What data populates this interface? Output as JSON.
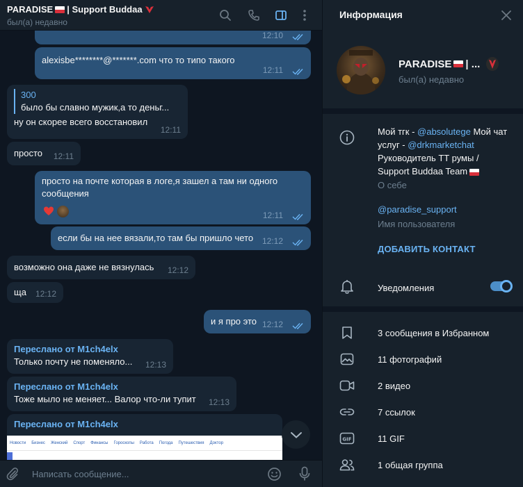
{
  "chat": {
    "title": "PARADISE",
    "title_suffix": "| Support Buddaa",
    "status": "был(а) недавно",
    "composer_placeholder": "Написать сообщение..."
  },
  "messages": [
    {
      "id": "m0",
      "dir": "out",
      "text": "",
      "time": "12:10"
    },
    {
      "id": "m1",
      "dir": "out",
      "text": "alexisbe********@*******.com что то типо такого",
      "time": "12:11"
    },
    {
      "id": "m2",
      "dir": "in",
      "reply_name": "300",
      "reply_text": "было бы славно мужик,а то деньг...",
      "text": "ну он скорее всего восстановил",
      "time": "12:11"
    },
    {
      "id": "m3",
      "dir": "in",
      "text": "просто",
      "time": "12:11"
    },
    {
      "id": "m4",
      "dir": "out",
      "text": "просто на почте которая в логе,я зашел а там ни одного сообщения",
      "time": "12:11",
      "reactions": [
        "heart",
        "avatar"
      ]
    },
    {
      "id": "m5",
      "dir": "out",
      "text": "если бы на нее вязали,то там бы пришло чето",
      "time": "12:12"
    },
    {
      "id": "m6",
      "dir": "in",
      "text": "возможно она даже не вязнулась",
      "time": "12:12"
    },
    {
      "id": "m7",
      "dir": "in",
      "text": "ща",
      "time": "12:12"
    },
    {
      "id": "m8",
      "dir": "out",
      "text": "и я про это",
      "time": "12:12"
    },
    {
      "id": "m9",
      "dir": "in",
      "fwd": "Переслано от M1ch4elx",
      "text": "Только почту не поменяло...",
      "time": "12:13"
    },
    {
      "id": "m10",
      "dir": "in",
      "fwd": "Переслано от M1ch4elx",
      "text": "Тоже мыло не меняет... Валор что-ли тупит",
      "time": "12:13"
    },
    {
      "id": "m11",
      "dir": "in",
      "fwd": "Переслано от M1ch4elx",
      "text": "",
      "time": ""
    }
  ],
  "preview_strip": {
    "tabs": [
      "Новости",
      "Бизнес",
      "Женский",
      "Спорт",
      "Финансы",
      "Гороскопы",
      "Работа",
      "Погода",
      "Путешествия",
      "Доктор"
    ]
  },
  "info": {
    "title": "Информация",
    "profile_name": "PARADISE",
    "profile_name_suffix": "| ...",
    "profile_status": "был(а) недавно",
    "bio_prefix": "Мой тгк - ",
    "bio_handle1": "@absolutege",
    "bio_mid": " Мой чат услуг - ",
    "bio_handle2": "@drkmarketchat",
    "bio_line3": "Руководитель TT румы /",
    "bio_line4": "Support Buddaa Team",
    "bio_label": "О себе",
    "username": "@paradise_support",
    "username_label": "Имя пользователя",
    "add_contact": "ДОБАВИТЬ КОНТАКТ",
    "notifications": "Уведомления",
    "notifications_on": true,
    "media": [
      {
        "icon": "bookmark-icon",
        "label": "3 сообщения в Избранном"
      },
      {
        "icon": "photo-icon",
        "label": "11 фотографий"
      },
      {
        "icon": "video-icon",
        "label": "2 видео"
      },
      {
        "icon": "link-icon",
        "label": "7 ссылок"
      },
      {
        "icon": "gif-icon",
        "label": "11 GIF"
      },
      {
        "icon": "group-icon",
        "label": "1 общая группа"
      }
    ]
  },
  "colors": {
    "chat_bg": "#0e1621",
    "panel_bg": "#17212b",
    "bubble_in": "#182533",
    "bubble_out": "#2b5278",
    "accent": "#6ab3f3"
  }
}
